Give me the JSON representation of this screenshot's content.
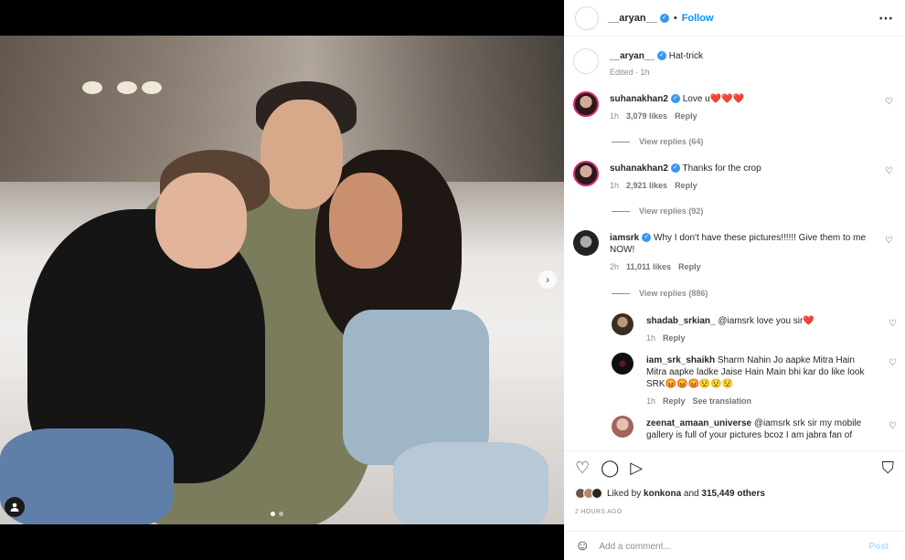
{
  "post": {
    "username": "__aryan__",
    "separator": "•",
    "follow_label": "Follow",
    "more_icon": "⋯"
  },
  "caption": {
    "username": "__aryan__",
    "text": "Hat-trick",
    "meta": "Edited · 1h"
  },
  "comments": [
    {
      "username": "suhanakhan2",
      "text": "Love u❤️❤️❤️",
      "time": "1h",
      "likes": "3,079 likes",
      "reply": "Reply",
      "view_replies": "View replies (64)"
    },
    {
      "username": "suhanakhan2",
      "text": "Thanks for the crop",
      "time": "1h",
      "likes": "2,921 likes",
      "reply": "Reply",
      "view_replies": "View replies (92)"
    },
    {
      "username": "iamsrk",
      "text": "Why I don't have these pictures!!!!!! Give them to me NOW!",
      "time": "2h",
      "likes": "11,011 likes",
      "reply": "Reply",
      "view_replies": "View replies (886)"
    }
  ],
  "replies": [
    {
      "username": "shadab_srkian_",
      "text": "@iamsrk love you sir❤️",
      "time": "1h",
      "reply": "Reply"
    },
    {
      "username": "iam_srk_shaikh",
      "text": "Sharm Nahin Jo aapke Mitra Hain Mitra aapke ladke Jaise Hain Main bhi kar do like look SRK😡😡😡😟😟😟",
      "time": "1h",
      "reply": "Reply",
      "translation": "See translation"
    },
    {
      "username": "zeenat_amaan_universe",
      "text": "@iamsrk srk sir my mobile gallery is full of your pictures bcoz I am jabra fan of",
      "time": "",
      "reply": ""
    }
  ],
  "footer": {
    "liked_prefix": "Liked by ",
    "liked_user": "konkona",
    "liked_and": " and ",
    "liked_others": "315,449 others",
    "timestamp": "2 HOURS AGO",
    "comment_placeholder": "Add a comment...",
    "post_label": "Post"
  },
  "icons": {
    "heart": "♡",
    "comment": "◯",
    "share": "▷",
    "save": "⛉",
    "emoji": "☺",
    "next": "›"
  },
  "colors": {
    "accent": "#0095f6",
    "verified": "#3897f0",
    "post_disabled": "#b2dffc"
  }
}
